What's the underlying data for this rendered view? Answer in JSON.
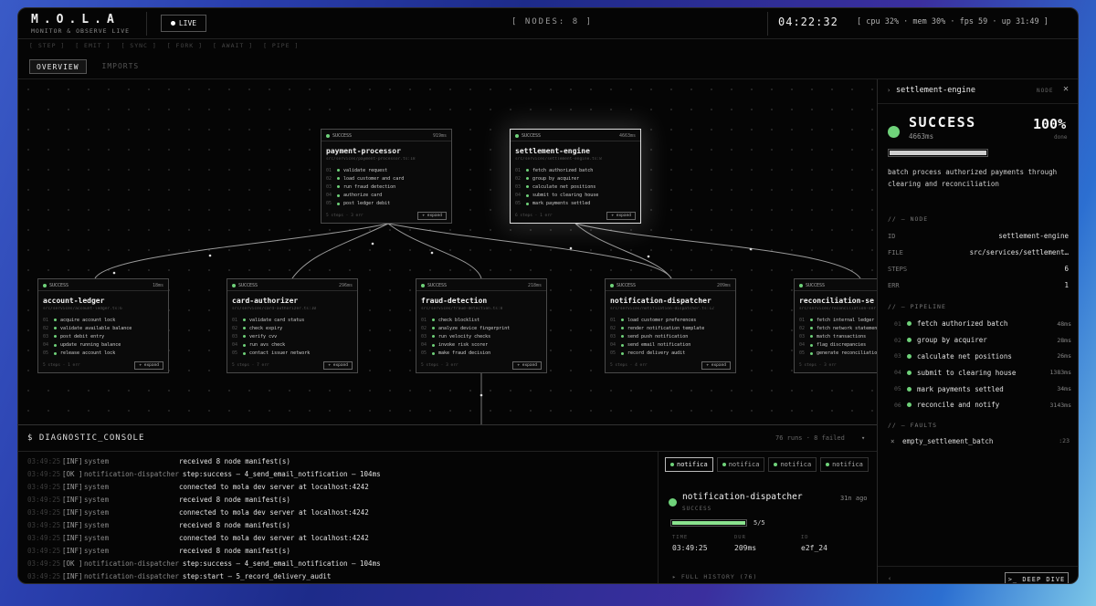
{
  "app": {
    "logo": "M.O.L.A",
    "subtitle": "MONITOR & OBSERVE LIVE",
    "live_label": "LIVE"
  },
  "header": {
    "nodes": "[ NODES: 8 ]",
    "clock": "04:22:32",
    "stats": "[ cpu 32%  ·  mem 30%  ·  fps 59  ·  up 31:49 ]"
  },
  "crumbs": [
    "[ STEP ]",
    "[ EMIT ]",
    "[ SYNC ]",
    "[ FORK ]",
    "[ AWAIT ]",
    "[ PIPE ]"
  ],
  "tabs": [
    {
      "label": "OVERVIEW",
      "active": true
    },
    {
      "label": "IMPORTS",
      "active": false
    }
  ],
  "nodes": [
    {
      "status": "SUCCESS",
      "time": "919ms",
      "name": "payment-processor",
      "path": "src/services/payment-processor.ts:18",
      "steps": [
        "validate request",
        "load customer and card",
        "run fraud detection",
        "authorize card",
        "post ledger debit"
      ],
      "footer": "5 steps · 3 err",
      "expand": "+ expand"
    },
    {
      "status": "SUCCESS",
      "time": "4663ms",
      "name": "settlement-engine",
      "path": "src/services/settlement-engine.ts:8",
      "steps": [
        "fetch authorized batch",
        "group by acquirer",
        "calculate net positions",
        "submit to clearing house",
        "mark payments settled"
      ],
      "footer": "6 steps · 1 err",
      "expand": "+ expand"
    },
    {
      "status": "SUCCESS",
      "time": "18ms",
      "name": "account-ledger",
      "path": "src/services/account-ledger.ts:6",
      "steps": [
        "acquire account lock",
        "validate available balance",
        "post debit entry",
        "update running balance",
        "release account lock"
      ],
      "footer": "5 steps · 1 err",
      "expand": "+ expand"
    },
    {
      "status": "SUCCESS",
      "time": "296ms",
      "name": "card-authorizer",
      "path": "src/services/card-authorizer.ts:10",
      "steps": [
        "validate card status",
        "check expiry",
        "verify cvv",
        "run avs check",
        "contact issuer network"
      ],
      "footer": "5 steps · 7 err",
      "expand": "+ expand"
    },
    {
      "status": "SUCCESS",
      "time": "218ms",
      "name": "fraud-detection",
      "path": "src/services/fraud-detection.ts:8",
      "steps": [
        "check blocklist",
        "analyze device fingerprint",
        "run velocity checks",
        "invoke risk scorer",
        "make fraud decision"
      ],
      "footer": "5 steps · 3 err",
      "expand": "+ expand"
    },
    {
      "status": "SUCCESS",
      "time": "209ms",
      "name": "notification-dispatcher",
      "path": "src/services/notification-dispatcher.ts:12",
      "steps": [
        "load customer preferences",
        "render notification template",
        "send push notification",
        "send email notification",
        "record delivery audit"
      ],
      "footer": "5 steps · 4 err",
      "expand": "+ expand"
    },
    {
      "status": "SUCCESS",
      "time": "",
      "name": "reconciliation-se",
      "path": "src/services/reconciliation-ser",
      "steps": [
        "fetch internal ledger",
        "fetch network statement",
        "match transactions",
        "flag discrepancies",
        "generate reconciliation"
      ],
      "footer": "5 steps · 3 err",
      "expand": "+ expand"
    }
  ],
  "console": {
    "title": "$ DIAGNOSTIC_CONSOLE",
    "meta": "76 runs · 8 failed",
    "caret": "▾",
    "logs": [
      {
        "time": "03:49:25",
        "level": "[INF]",
        "source": "system",
        "msg": "received 8 node manifest(s)"
      },
      {
        "time": "03:49:25",
        "level": "[OK ]",
        "source": "notification-dispatcher",
        "msg": "step:success — 4_send_email_notification — 104ms"
      },
      {
        "time": "03:49:25",
        "level": "[INF]",
        "source": "system",
        "msg": "connected to mola dev server at localhost:4242"
      },
      {
        "time": "03:49:25",
        "level": "[INF]",
        "source": "system",
        "msg": "received 8 node manifest(s)"
      },
      {
        "time": "03:49:25",
        "level": "[INF]",
        "source": "system",
        "msg": "connected to mola dev server at localhost:4242"
      },
      {
        "time": "03:49:25",
        "level": "[INF]",
        "source": "system",
        "msg": "received 8 node manifest(s)"
      },
      {
        "time": "03:49:25",
        "level": "[INF]",
        "source": "system",
        "msg": "connected to mola dev server at localhost:4242"
      },
      {
        "time": "03:49:25",
        "level": "[INF]",
        "source": "system",
        "msg": "received 8 node manifest(s)"
      },
      {
        "time": "03:49:25",
        "level": "[OK ]",
        "source": "notification-dispatcher",
        "msg": "step:success — 4_send_email_notification — 104ms"
      },
      {
        "time": "03:49:25",
        "level": "[INF]",
        "source": "notification-dispatcher",
        "msg": "step:start — 5_record_delivery_audit"
      }
    ],
    "detail": {
      "tabs": [
        "notifica",
        "notifica",
        "notifica",
        "notifica"
      ],
      "name": "notification-dispatcher",
      "ago": "31n ago",
      "status": "SUCCESS",
      "progress": 1.0,
      "fraction": "5/5",
      "time_label": "TIME",
      "time": "03:49:25",
      "dur_label": "DUR",
      "dur": "209ms",
      "id_label": "ID",
      "id": "e2f_24",
      "history": "▸ FULL HISTORY (76)"
    }
  },
  "panel": {
    "caret": "›",
    "title": "settlement-engine",
    "kind": "NODE",
    "close": "✕",
    "status": "SUCCESS",
    "ms": "4663ms",
    "pct": "100%",
    "done": "done",
    "progress": 1.0,
    "description": "batch process authorized payments through clearing and reconciliation",
    "node_section": "// — NODE",
    "kv": [
      {
        "k": "ID",
        "v": "settlement-engine"
      },
      {
        "k": "FILE",
        "v": "src/services/settlement…"
      },
      {
        "k": "STEPS",
        "v": "6"
      },
      {
        "k": "ERR",
        "v": "1"
      }
    ],
    "pipeline_section": "// — PIPELINE",
    "pipeline": [
      {
        "n": "01",
        "label": "fetch authorized batch",
        "t": "48ms"
      },
      {
        "n": "02",
        "label": "group by acquirer",
        "t": "28ms"
      },
      {
        "n": "03",
        "label": "calculate net positions",
        "t": "26ms"
      },
      {
        "n": "04",
        "label": "submit to clearing house",
        "t": "1383ms"
      },
      {
        "n": "05",
        "label": "mark payments settled",
        "t": "34ms"
      },
      {
        "n": "06",
        "label": "reconcile and notify",
        "t": "3143ms"
      }
    ],
    "faults_section": "// — FAULTS",
    "faults": [
      {
        "x": "×",
        "name": "empty_settlement_batch",
        "n": ":23"
      }
    ],
    "footer_caret": "‹",
    "deep_dive": ">_ DEEP DIVE"
  }
}
